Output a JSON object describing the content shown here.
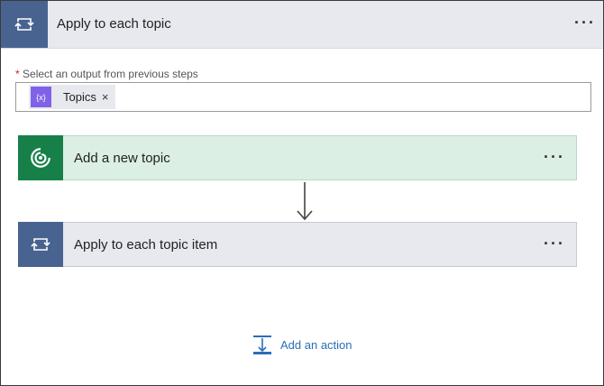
{
  "outer_card": {
    "title": "Apply to each topic",
    "more_label": "···",
    "icon": "loop-icon"
  },
  "output_field": {
    "required_marker": "*",
    "label": "Select an output from previous steps",
    "token": {
      "icon_text": "{x}",
      "label": "Topics",
      "remove": "×"
    }
  },
  "add_topic_card": {
    "title": "Add a new topic",
    "more_label": "···",
    "icon": "dataverse-icon",
    "color": "#178049"
  },
  "apply_item_card": {
    "title": "Apply to each topic item",
    "more_label": "···",
    "icon": "loop-icon",
    "color": "#48638f"
  },
  "add_action": {
    "label": "Add an action",
    "icon": "add-action-icon",
    "color": "#2a6fb6"
  }
}
